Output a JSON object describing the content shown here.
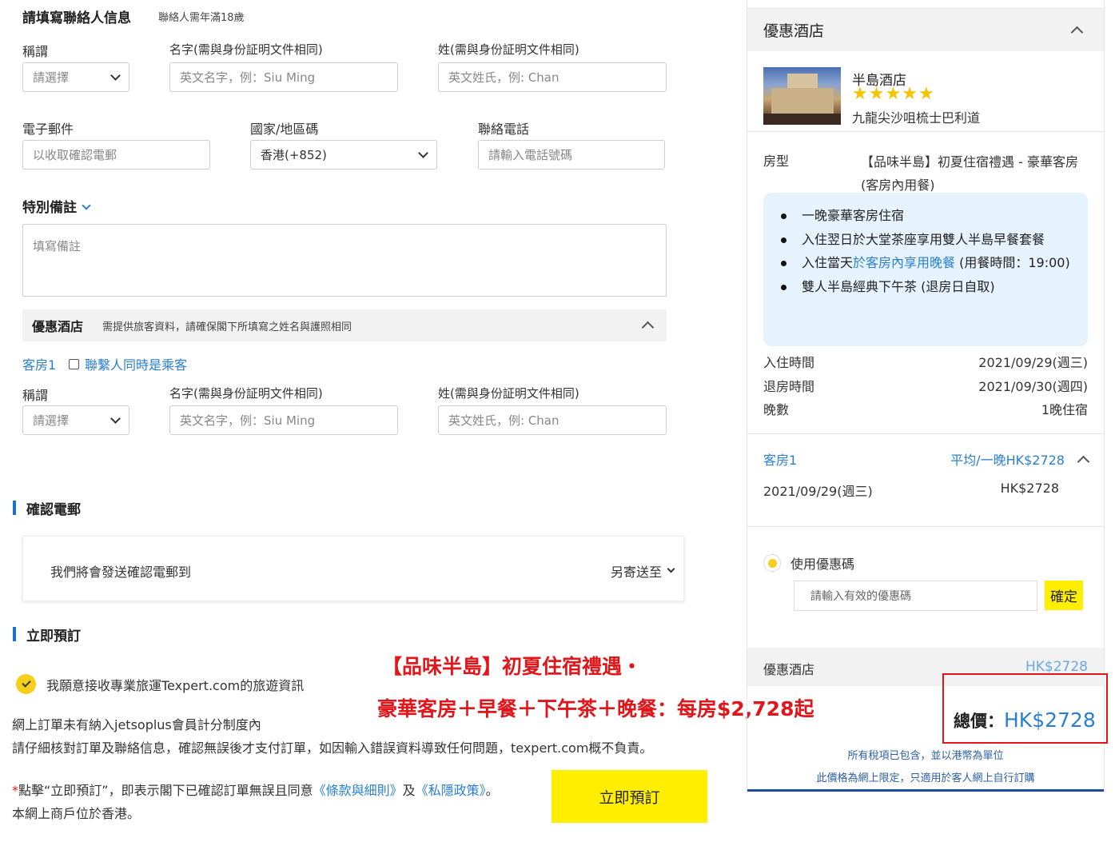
{
  "contact": {
    "title": "請填寫聯絡人信息",
    "note": "聯絡人需年滿18歲",
    "salutation_label": "稱謂",
    "salutation_placeholder": "請選擇",
    "first_name_label": "名字(需與身份証明文件相同)",
    "first_name_placeholder": "英文名字，例：Siu Ming",
    "last_name_label": "姓(需與身份証明文件相同)",
    "last_name_placeholder": "英文姓氏，例: Chan",
    "email_label": "電子郵件",
    "email_placeholder": "以收取確認電郵",
    "country_label": "國家/地區碼",
    "country_value": "香港(+852)",
    "phone_label": "聯絡電話",
    "phone_placeholder": "請輸入電話號碼"
  },
  "remarks": {
    "title": "特別備註",
    "placeholder": "填寫備註"
  },
  "hotel_guest": {
    "title": "優惠酒店",
    "note": "需提供旅客資料，請確保閣下所填寫之姓名與護照相同",
    "room_label": "客房1",
    "same_as_contact": "聯繫人同時是乘客",
    "salutation_label": "稱謂",
    "salutation_placeholder": "請選擇",
    "first_name_label": "名字(需與身份証明文件相同)",
    "first_name_placeholder": "英文名字，例：Siu Ming",
    "last_name_label": "姓(需與身份証明文件相同)",
    "last_name_placeholder": "英文姓氏，例: Chan"
  },
  "confirm_email": {
    "title": "確認電郵",
    "text": "我們將會發送確認電郵到",
    "send_to": "另寄送至"
  },
  "booking": {
    "title": "立即預訂",
    "newsletter": "我願意接收專業旅運Texpert.com的旅遊資訊",
    "note1": "網上訂單未有納入jetsoplus會員計分制度內",
    "note2": "請仔細核對訂單及聯絡信息，確認無誤後才支付訂單，如因輸入錯誤資料導致任何問題，texpert.com概不負責。",
    "terms_prefix": "*",
    "terms_a": "點擊“立即預訂”，即表示閣下已確認訂單無誤且同意",
    "terms_link1": "《條款與細則》",
    "terms_and": "及",
    "terms_link2": "《私隱政策》",
    "terms_end": "。",
    "merchant": "本網上商戶位於香港。",
    "button": "立即預訂"
  },
  "promo_overlay": {
    "line1": "【品味半島】初夏住宿禮遇・",
    "line2": "豪華客房＋早餐＋下午茶＋晚餐：每房$2,728起"
  },
  "summary": {
    "header": "優惠酒店",
    "hotel_name": "半島酒店",
    "stars": 5,
    "address": "九龍尖沙咀梳士巴利道",
    "room_type_label": "房型",
    "room_type": "【品味半島】初夏住宿禮遇 - 豪華客房 (客房內用餐)",
    "perks": [
      {
        "a": "一晚豪華客房住宿",
        "link": "",
        "b": ""
      },
      {
        "a": "入住翌日於大堂茶座享用雙人半島早餐套餐",
        "link": "",
        "b": ""
      },
      {
        "a": "入住當天",
        "link": "於客房內享用晚餐",
        "b": " (用餐時間：19:00)"
      },
      {
        "a": "雙人半島經典下午茶 (退房日自取)",
        "link": "",
        "b": ""
      }
    ],
    "checkin_label": "入住時間",
    "checkin": "2021/09/29(週三)",
    "checkout_label": "退房時間",
    "checkout": "2021/09/30(週四)",
    "nights_label": "晚數",
    "nights": "1晚住宿",
    "room_label": "客房1",
    "avg_price": "平均/一晚HK$2728",
    "night_date": "2021/09/29(週三)",
    "night_price": "HK$2728",
    "coupon_label": "使用優惠碼",
    "coupon_placeholder": "請輸入有效的優惠碼",
    "coupon_button": "確定",
    "subtotal_label": "優惠酒店",
    "subtotal": "HK$2728",
    "total_label": "總價：",
    "total": "HK$2728",
    "tax_note": "所有稅項已包含，並以港幣為單位",
    "online_note": "此價格為網上限定，只適用於客人網上自行訂購"
  },
  "colors": {
    "accent_blue": "#2a7fd0",
    "yellow": "#ffee00",
    "promo_red": "#e0161b",
    "highlight_box": "#e0161b"
  }
}
